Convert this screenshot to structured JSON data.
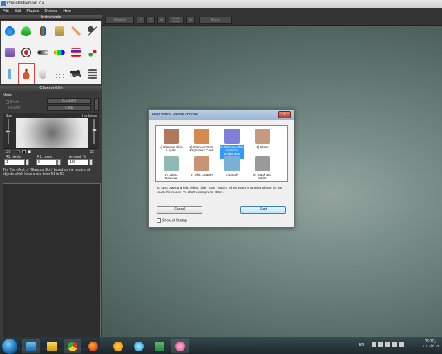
{
  "window": {
    "title": "PhotoInstrument 7.3"
  },
  "menu": [
    "File",
    "Edit",
    "Plugins",
    "Options",
    "Help"
  ],
  "instruments": {
    "title": "Instruments"
  },
  "glamour": {
    "title": "Glamour Skin",
    "mode_label": "Mode",
    "blush": "Blush",
    "eraser": "Eraser",
    "brush_fill": "Brush/Fill",
    "clear": "Clear",
    "size_label": "Size",
    "hardness_label": "Hardness",
    "size_value": "151",
    "hardness_value": "52",
    "r1_label": "R1, pixels",
    "r2_label": "R2, pixels",
    "amount_label": "Amount, %",
    "r1_value": "1",
    "r2_value": "8",
    "amount_value": "100",
    "tip": "Tip: The effect of \"Glamour Skin\" based on the blurring of objects which have a size from R1 to R2"
  },
  "toolbar": {
    "original": "Original",
    "zoom": "1000%",
    "zoom2": "100%",
    "apply": "Apply"
  },
  "dialog": {
    "title": "Help Video: Please choose...",
    "close": "x",
    "videos": [
      {
        "label": "1) Glamour Skin, Liquify",
        "color": "#b07a5a"
      },
      {
        "label": "2) Glamour Skin, Brightness Cont.",
        "color": "#d68a4e"
      },
      {
        "label": "3) Glamour Skin, Colorize, Brightness Contra...",
        "color": "#7f7fd8"
      },
      {
        "label": "4) Clone",
        "color": "#c79a80"
      },
      {
        "label": "5) Object Removal",
        "color": "#8fb9b3"
      },
      {
        "label": "6) Skin Cleaner",
        "color": "#c99474"
      },
      {
        "label": "7) Liquify",
        "color": "#7ab0d6"
      },
      {
        "label": "8) Black and White",
        "color": "#9a9a9a"
      }
    ],
    "instruction": "To start playing a help video, click \"Start\" button. When video is running please do not touch the mouse. To abort video press <Esc>.",
    "cancel": "Cancel",
    "start": "Start",
    "show_at_startup": "Show At Startup"
  },
  "taskbar": {
    "lang": "EN",
    "time": "05:07 م",
    "date": "١٠/٠٤/٢٠١٢"
  }
}
